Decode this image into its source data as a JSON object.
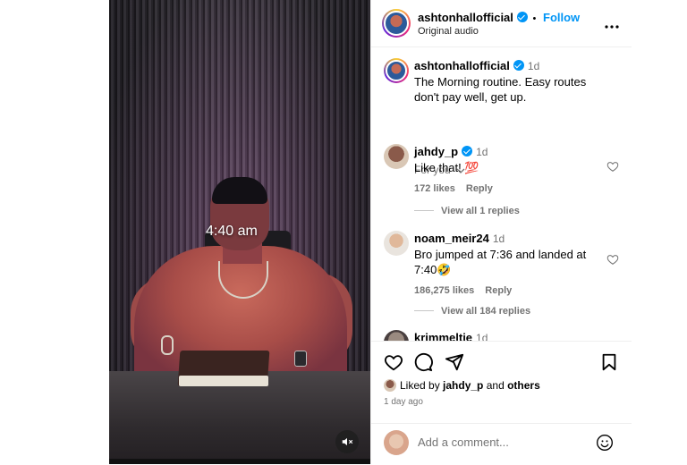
{
  "video": {
    "time_overlay": "4:40 am",
    "mute_icon": "muted-speaker-icon"
  },
  "header": {
    "username": "ashtonhallofficial",
    "follow_label": "Follow",
    "separator": "•",
    "subtitle": "Original audio",
    "more_icon": "more-horizontal-icon"
  },
  "caption": {
    "username": "ashtonhallofficial",
    "time": "1d",
    "text": "The Morning routine. Easy routes don't pay well, get up."
  },
  "for_you": "For you",
  "comments": [
    {
      "username": "jahdy_p",
      "verified": true,
      "time": "1d",
      "text": "Like that! 💯",
      "likes": "172 likes",
      "reply": "Reply",
      "view_all": "View all 1 replies"
    },
    {
      "username": "noam_meir24",
      "verified": false,
      "time": "1d",
      "text": "Bro jumped at 7:36 and landed at 7:40🤣",
      "likes": "186,275 likes",
      "reply": "Reply",
      "view_all": "View all 184 replies"
    },
    {
      "username": "krimmeltie",
      "verified": false,
      "time": "1d"
    }
  ],
  "actions": {
    "liked_by_prefix": "Liked by ",
    "liked_by_user": "jahdy_p",
    "liked_by_and": " and ",
    "liked_by_others": "others",
    "posted": "1 day ago"
  },
  "add_comment": {
    "placeholder": "Add a comment..."
  },
  "colors": {
    "accent": "#0095f6",
    "muted": "#737373"
  }
}
